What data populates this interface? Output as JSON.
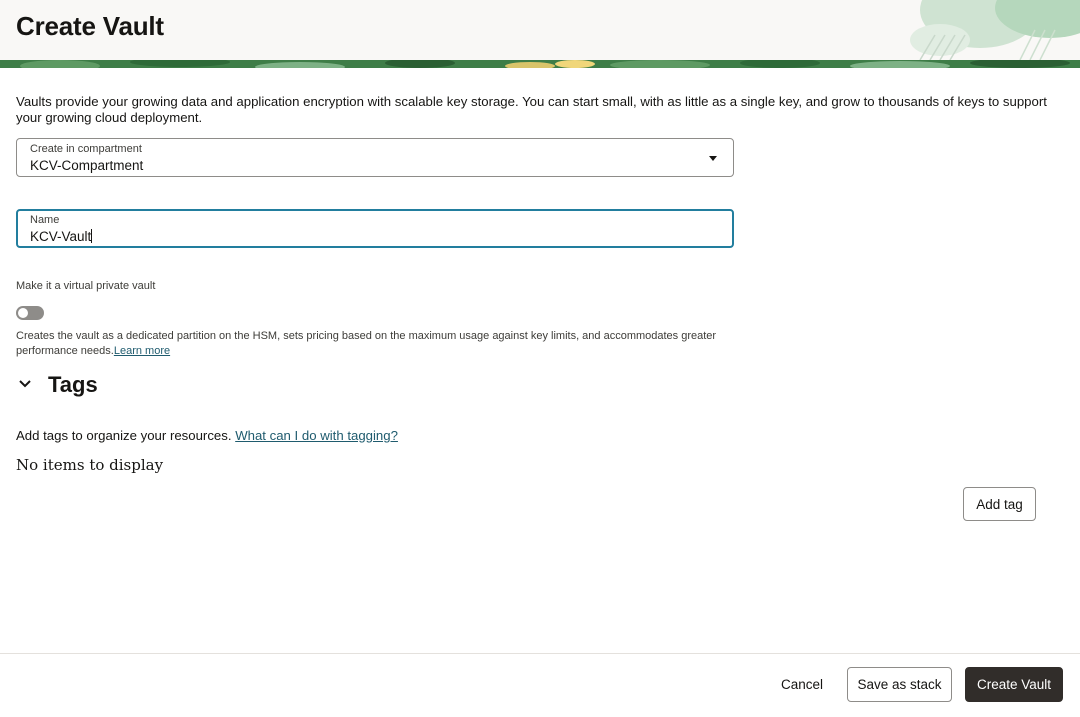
{
  "page": {
    "title": "Create Vault",
    "intro": "Vaults provide your growing data and application encryption with scalable key storage. You can start small, with as little as a single key, and grow to thousands of keys to support your growing cloud deployment."
  },
  "form": {
    "compartment": {
      "label": "Create in compartment",
      "value": "KCV-Compartment"
    },
    "name": {
      "label": "Name",
      "value": "KCV-Vault"
    },
    "virtual_private_vault": {
      "label": "Make it a virtual private vault",
      "enabled": false,
      "help": "Creates the vault as a dedicated partition on the HSM, sets pricing based on the maximum usage against key limits, and accommodates greater performance needs.",
      "learn_more": "Learn more"
    }
  },
  "tags": {
    "heading": "Tags",
    "intro": "Add tags to organize your resources.",
    "help_link": "What can I do with tagging?",
    "empty": "No items to display",
    "add_label": "Add tag"
  },
  "footer": {
    "cancel": "Cancel",
    "save_stack": "Save as stack",
    "create": "Create Vault"
  },
  "colors": {
    "primary_button": "#312d2a",
    "focus_border": "#227e9e",
    "link": "#1f5b6e",
    "banner_green": "#3e7d47"
  }
}
